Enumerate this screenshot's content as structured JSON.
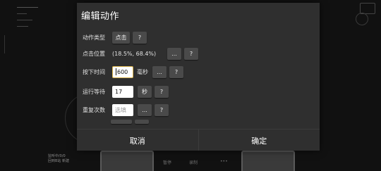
{
  "background": {
    "bottom_left_line1": "监听中/0/0",
    "bottom_left_line2": "回到B站 新建",
    "bottom_center_left": "暂停",
    "bottom_center_mid": "录制",
    "bottom_center_right": "•••"
  },
  "dialog": {
    "title": "编辑动作",
    "help_label": "?",
    "more_label": "...",
    "rows": {
      "action_type": {
        "label": "动作类型",
        "value": "点击"
      },
      "click_position": {
        "label": "点击位置",
        "value": "(18.5%, 68.4%)"
      },
      "press_time": {
        "label": "按下时间",
        "value": "600",
        "unit": "毫秒"
      },
      "run_wait": {
        "label": "运行等待",
        "value": "17",
        "unit": "秒"
      },
      "repeat_count": {
        "label": "重复次数",
        "placeholder": "选填"
      }
    },
    "footer": {
      "cancel": "取消",
      "confirm": "确定"
    }
  }
}
